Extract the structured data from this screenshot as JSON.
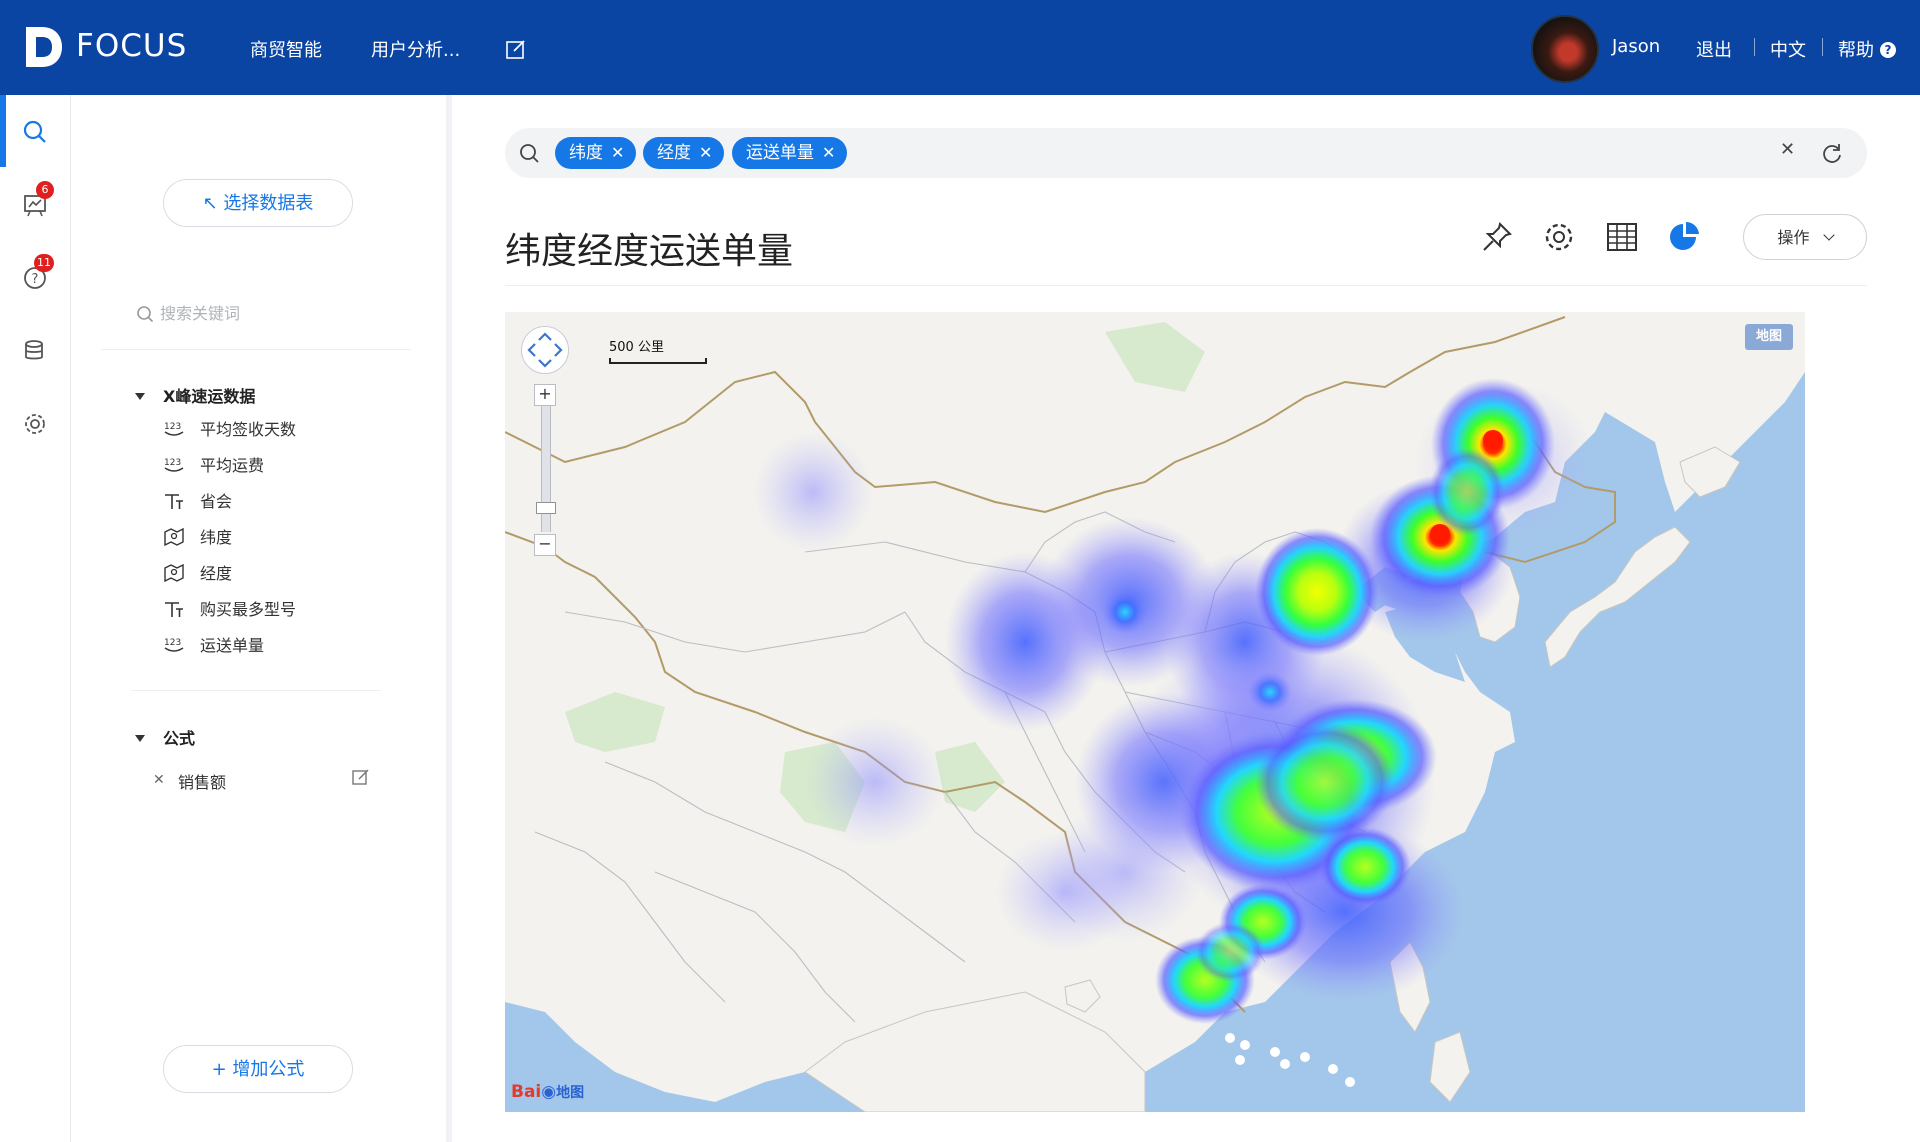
{
  "app": {
    "logo_text": "FOCUS",
    "nav": [
      "商贸智能",
      "用户分析..."
    ],
    "user_name": "Jason",
    "logout": "退出",
    "language": "中文",
    "help": "帮助"
  },
  "rail": {
    "badges": {
      "reports": "6",
      "questions": "11"
    }
  },
  "panel": {
    "select_table": "↖ 选择数据表",
    "search_placeholder": "搜索关键词",
    "dataset_title": "X峰速运数据",
    "fields": [
      {
        "label": "平均签收天数",
        "icon": "number-icon"
      },
      {
        "label": "平均运费",
        "icon": "number-icon"
      },
      {
        "label": "省会",
        "icon": "text-icon"
      },
      {
        "label": "纬度",
        "icon": "geo-icon"
      },
      {
        "label": "经度",
        "icon": "geo-icon"
      },
      {
        "label": "购买最多型号",
        "icon": "text-icon"
      },
      {
        "label": "运送单量",
        "icon": "number-icon"
      }
    ],
    "formula_title": "公式",
    "formula_item": "销售额",
    "add_formula": "+ 增加公式"
  },
  "main": {
    "chips": [
      "纬度",
      "经度",
      "运送单量"
    ],
    "title": "纬度经度运送单量",
    "operations": "操作"
  },
  "map": {
    "scale_label": "500 公里",
    "map_type": "地图",
    "logo": "Bai地图"
  },
  "colors": {
    "topbar": "#0a45a4",
    "accent": "#1677e6",
    "sea": "#a3c7ea",
    "land": "#f3f2ee"
  }
}
